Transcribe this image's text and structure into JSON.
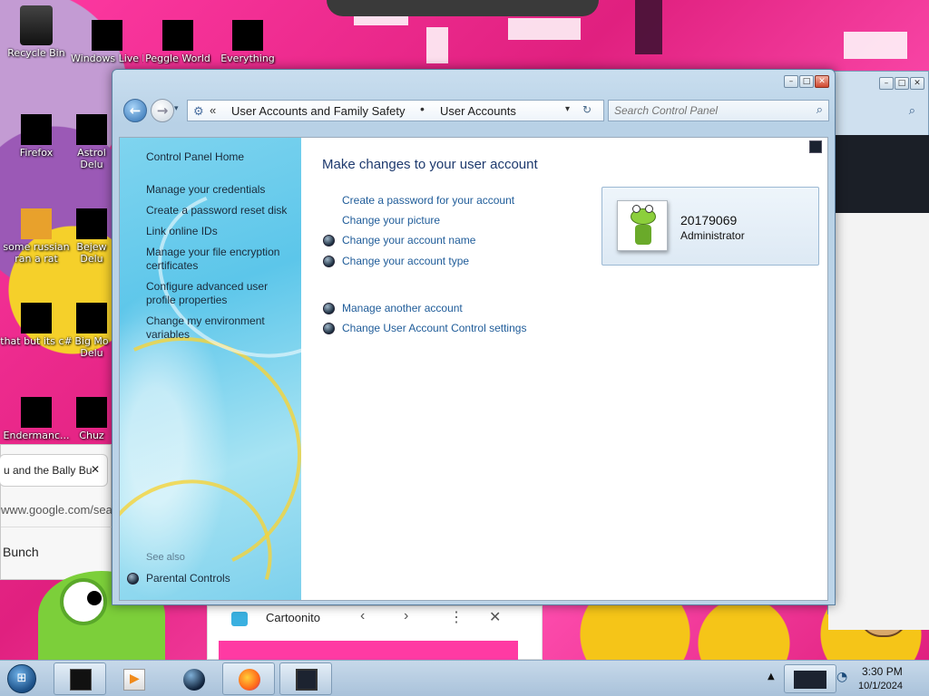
{
  "desktop": {
    "icons": [
      {
        "label": "Recycle Bin"
      },
      {
        "label": "Windows Live Ma"
      },
      {
        "label": "Peggle World"
      },
      {
        "label": "Everything"
      },
      {
        "label": "Firefox"
      },
      {
        "label": "Astrol Delu"
      },
      {
        "label": "some russian ran a rat"
      },
      {
        "label": "Bejew Delu"
      },
      {
        "label": "that but its c#"
      },
      {
        "label": "Big Mo Delu"
      },
      {
        "label": "Endermanc..."
      },
      {
        "label": "Chuz"
      }
    ],
    "browser_fragment": {
      "tab_title": "u and the Bally Bu",
      "tab_close": "✕",
      "url": "www.google.com/sear",
      "search_text": "Bunch",
      "video_tab": "Cartoonito"
    }
  },
  "window": {
    "caption_buttons": {
      "minimize": "–",
      "maximize": "□",
      "close": "✕"
    },
    "nav": {
      "back_glyph": "←",
      "forward_glyph": "→",
      "recent_glyph": "▾",
      "breadcrumb_overflow": "«",
      "breadcrumb": [
        "User Accounts and Family Safety",
        "User Accounts"
      ],
      "separator": "•",
      "dropdown_glyph": "▾",
      "refresh_glyph": "↻"
    },
    "search": {
      "placeholder": "Search Control Panel"
    },
    "left_pane": {
      "home": "Control Panel Home",
      "links": [
        "Manage your credentials",
        "Create a password reset disk",
        "Link online IDs",
        "Manage your file encryption certificates",
        "Configure advanced user profile properties",
        "Change my environment variables"
      ],
      "see_also": "See also",
      "see_also_links": [
        "Parental Controls"
      ]
    },
    "main": {
      "title": "Make changes to your user account",
      "tasks": [
        {
          "label": "Create a password for your account",
          "icon": "none"
        },
        {
          "label": "Change your picture",
          "icon": "none"
        },
        {
          "label": "Change your account name",
          "icon": "shield-globe-icon"
        },
        {
          "label": "Change your account type",
          "icon": "shield-globe-icon"
        }
      ],
      "other_tasks": [
        {
          "label": "Manage another account",
          "icon": "shield-globe-icon"
        },
        {
          "label": "Change User Account Control settings",
          "icon": "shield-globe-icon"
        }
      ],
      "account": {
        "name": "20179069",
        "role": "Administrator",
        "picture": "frog-avatar"
      }
    }
  },
  "taskbar": {
    "start_glyph": "⊞",
    "buttons": [
      "black-window-icon",
      "media-player-icon",
      "globe-icon",
      "firefox-icon",
      "monitor-icon"
    ],
    "tray": {
      "time": "3:30 PM",
      "date": "10/1/2024"
    }
  },
  "colors": {
    "accent": "#1f5c99",
    "wallpaper": "#e8338f",
    "left_pane": "#5cc6ea",
    "title": "#1e3a6e"
  }
}
